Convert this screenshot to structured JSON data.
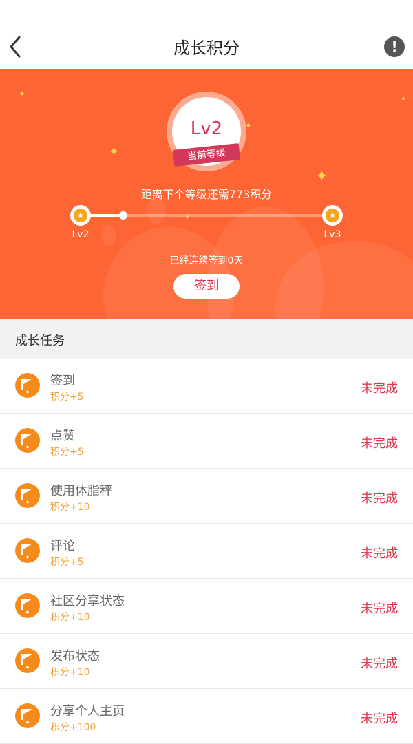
{
  "nav": {
    "title": "成长积分",
    "info_label": "!"
  },
  "level": {
    "current": "Lv2",
    "badge": "当前等级",
    "remaining_text": "距离下个等级还需773积分",
    "progress_fraction": 0.17,
    "start_label": "Lv2",
    "end_label": "Lv3",
    "streak_text": "已经连续签到0天",
    "checkin_label": "签到"
  },
  "section": {
    "title": "成长任务"
  },
  "tasks": [
    {
      "name": "签到",
      "points": "积分+5",
      "status": "未完成"
    },
    {
      "name": "点赞",
      "points": "积分+5",
      "status": "未完成"
    },
    {
      "name": "使用体脂秤",
      "points": "积分+10",
      "status": "未完成"
    },
    {
      "name": "评论",
      "points": "积分+5",
      "status": "未完成"
    },
    {
      "name": "社区分享状态",
      "points": "积分+10",
      "status": "未完成"
    },
    {
      "name": "发布状态",
      "points": "积分+10",
      "status": "未完成"
    },
    {
      "name": "分享个人主页",
      "points": "积分+100",
      "status": "未完成"
    }
  ],
  "colors": {
    "banner": "#fe6534",
    "accent": "#e0344b",
    "points": "#f0a23a",
    "icon": "#f68b1d"
  }
}
